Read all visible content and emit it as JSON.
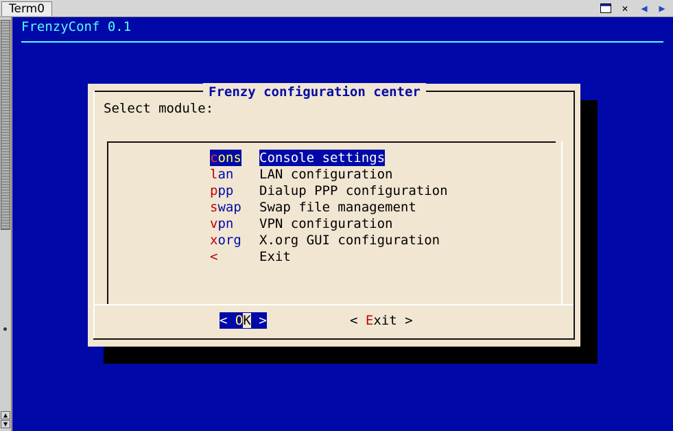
{
  "window": {
    "tab_title": "Term0",
    "controls": [
      "maximize-icon",
      "close-icon",
      "prev-icon",
      "next-icon"
    ]
  },
  "app": {
    "title": "FrenzyConf 0.1"
  },
  "dialog": {
    "title": "Frenzy configuration center",
    "prompt": "Select module:",
    "items": [
      {
        "tag_hotkey": "c",
        "tag_rest": "ons",
        "desc": "Console settings",
        "selected": true
      },
      {
        "tag_hotkey": "l",
        "tag_rest": "an",
        "desc": "LAN configuration",
        "selected": false
      },
      {
        "tag_hotkey": "p",
        "tag_rest": "pp",
        "desc": "Dialup PPP configuration",
        "selected": false
      },
      {
        "tag_hotkey": "s",
        "tag_rest": "wap",
        "desc": "Swap file management",
        "selected": false
      },
      {
        "tag_hotkey": "v",
        "tag_rest": "pn",
        "desc": "VPN configuration",
        "selected": false
      },
      {
        "tag_hotkey": "x",
        "tag_rest": "org",
        "desc": "X.org GUI configuration",
        "selected": false
      },
      {
        "tag_hotkey": "<",
        "tag_rest": "",
        "desc": "Exit",
        "selected": false
      }
    ],
    "buttons": {
      "ok": {
        "open": "< ",
        "hotkey": "O",
        "rest": "K",
        "close": " >"
      },
      "exit": {
        "open": "< ",
        "hotkey": "E",
        "rest": "xit",
        "close": " >"
      }
    }
  },
  "colors": {
    "terminal_bg": "#0009a8",
    "dialog_bg": "#f1e6d2",
    "title_cyan": "#55ffff",
    "hotkey_red": "#c00000",
    "highlight_yellow": "#ffff55"
  }
}
